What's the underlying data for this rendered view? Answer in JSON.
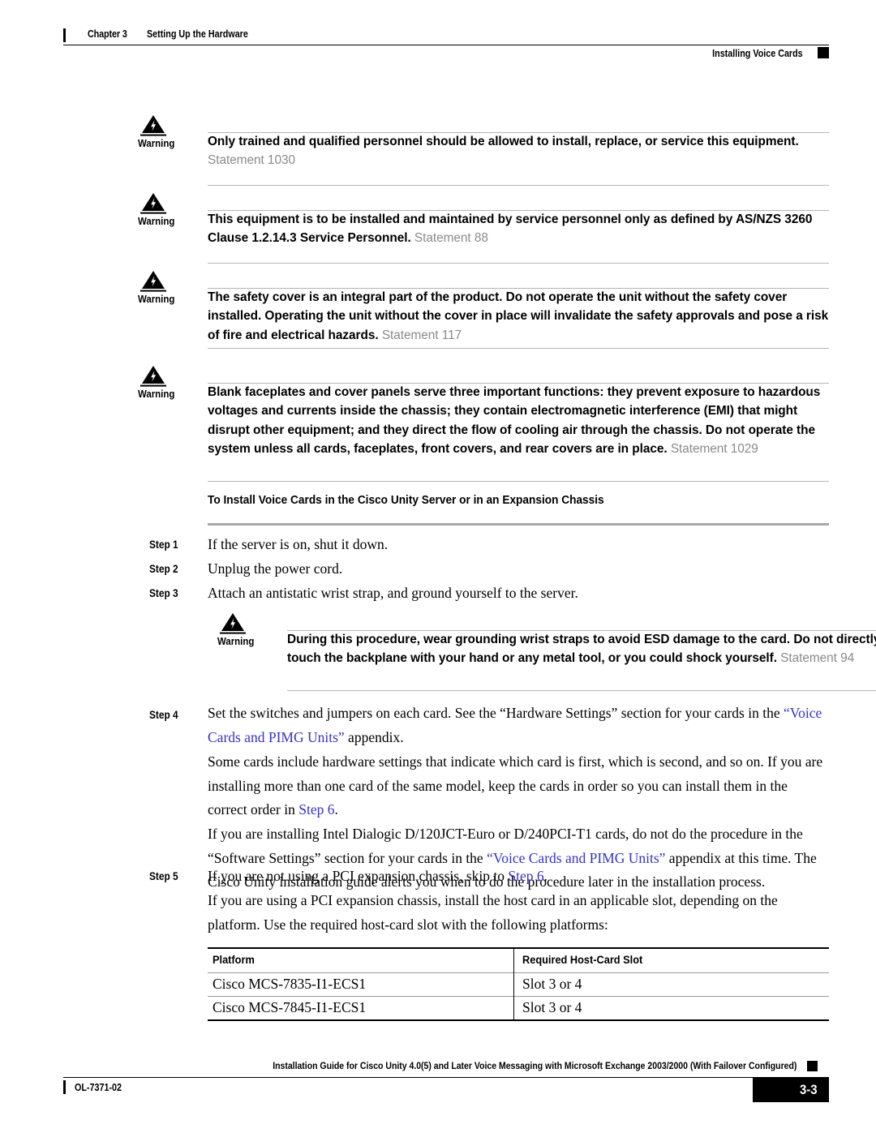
{
  "header": {
    "chapter": "Chapter 3",
    "chapter_title": "Setting Up the Hardware",
    "section": "Installing Voice Cards"
  },
  "warnings": [
    {
      "label": "Warning",
      "icon": "warning-triangle-icon",
      "text": "Only trained and qualified personnel should be allowed to install, replace, or service this equipment.",
      "statement": "Statement 1030"
    },
    {
      "label": "Warning",
      "icon": "warning-triangle-icon",
      "text": "This equipment is to be installed and maintained by service personnel only as defined by AS/NZS 3260 Clause 1.2.14.3 Service Personnel.",
      "statement": "Statement 88"
    },
    {
      "label": "Warning",
      "icon": "warning-triangle-icon",
      "text": "The safety cover is an integral part of the product. Do not operate the unit without the safety cover installed. Operating the unit without the cover in place will invalidate the safety approvals and pose a risk of fire and electrical hazards.",
      "statement": "Statement 117"
    },
    {
      "label": "Warning",
      "icon": "warning-triangle-icon",
      "text": "Blank faceplates and cover panels serve three important functions: they prevent exposure to hazardous voltages and currents inside the chassis; they contain electromagnetic interference (EMI) that might disrupt other equipment; and they direct the flow of cooling air through the chassis. Do not operate the system unless all cards, faceplates, front covers, and rear covers are in place.",
      "statement": "Statement 1029"
    }
  ],
  "procedure": {
    "heading": "To Install Voice Cards in the Cisco Unity Server or in an Expansion Chassis",
    "steps": [
      {
        "label": "Step 1",
        "text": "If the server is on, shut it down."
      },
      {
        "label": "Step 2",
        "text": "Unplug the power cord."
      },
      {
        "label": "Step 3",
        "text": "Attach an antistatic wrist strap, and ground yourself to the server."
      },
      {
        "label": "Step 4",
        "text": "Set the switches and jumpers on each card. See the “Hardware Settings” section for your cards in the “Voice Cards and PIMG Units” appendix."
      },
      {
        "label": "Step 5",
        "text": "If you are not using a PCI expansion chassis, skip to Step 6."
      }
    ]
  },
  "inline_warning": {
    "label": "Warning",
    "icon": "warning-triangle-icon",
    "text": "During this procedure, wear grounding wrist straps to avoid ESD damage to the card. Do not directly touch the backplane with your hand or any metal tool, or you could shock yourself.",
    "statement": "Statement 94"
  },
  "step4": {
    "lead_1": "Set the switches and jumpers on each card. See the “Hardware Settings” section for your cards in the ",
    "link_1": "“Voice Cards and PIMG Units”",
    "lead_2": " appendix.",
    "para_a_1": "Some cards include hardware settings that indicate which card is first, which is second, and so on. If you are installing more than one card of the same model, keep the cards in order so you can install them in the correct order in ",
    "para_a_link": "Step 6",
    "para_a_2": ".",
    "para_b_1": "If you are installing Intel Dialogic D/120JCT-Euro or D/240PCI-T1 cards, do not do the procedure in the “Software Settings” section for your cards in the ",
    "para_b_link": "“Voice Cards and PIMG Units”",
    "para_b_2": " appendix at this time. The Cisco Unity installation guide alerts you when to do the procedure later in the installation process."
  },
  "step5": {
    "lead_1": "If you are not using a PCI expansion chassis, skip to ",
    "link_1": "Step 6",
    "lead_2": ".",
    "para_a": "If you are using a PCI expansion chassis, install the host card in an applicable slot, depending on the platform. Use the required host-card slot with the following platforms:"
  },
  "table": {
    "columns": [
      "Platform",
      "Required Host-Card Slot"
    ],
    "rows": [
      [
        "Cisco MCS-7835-I1-ECS1",
        "Slot 3 or 4"
      ],
      [
        "Cisco MCS-7845-I1-ECS1",
        "Slot 3 or 4"
      ]
    ]
  },
  "footer": {
    "title": "Installation Guide for Cisco Unity 4.0(5) and Later Voice Messaging with Microsoft Exchange 2003/2000 (With Failover Configured)",
    "doc_number": "OL-7371-02",
    "page_number": "3-3"
  },
  "colors": {
    "link": "#3333cc",
    "statement_gray": "#8a8a8a",
    "rule_gray": "#b5b5b5",
    "ink": "#000000"
  }
}
